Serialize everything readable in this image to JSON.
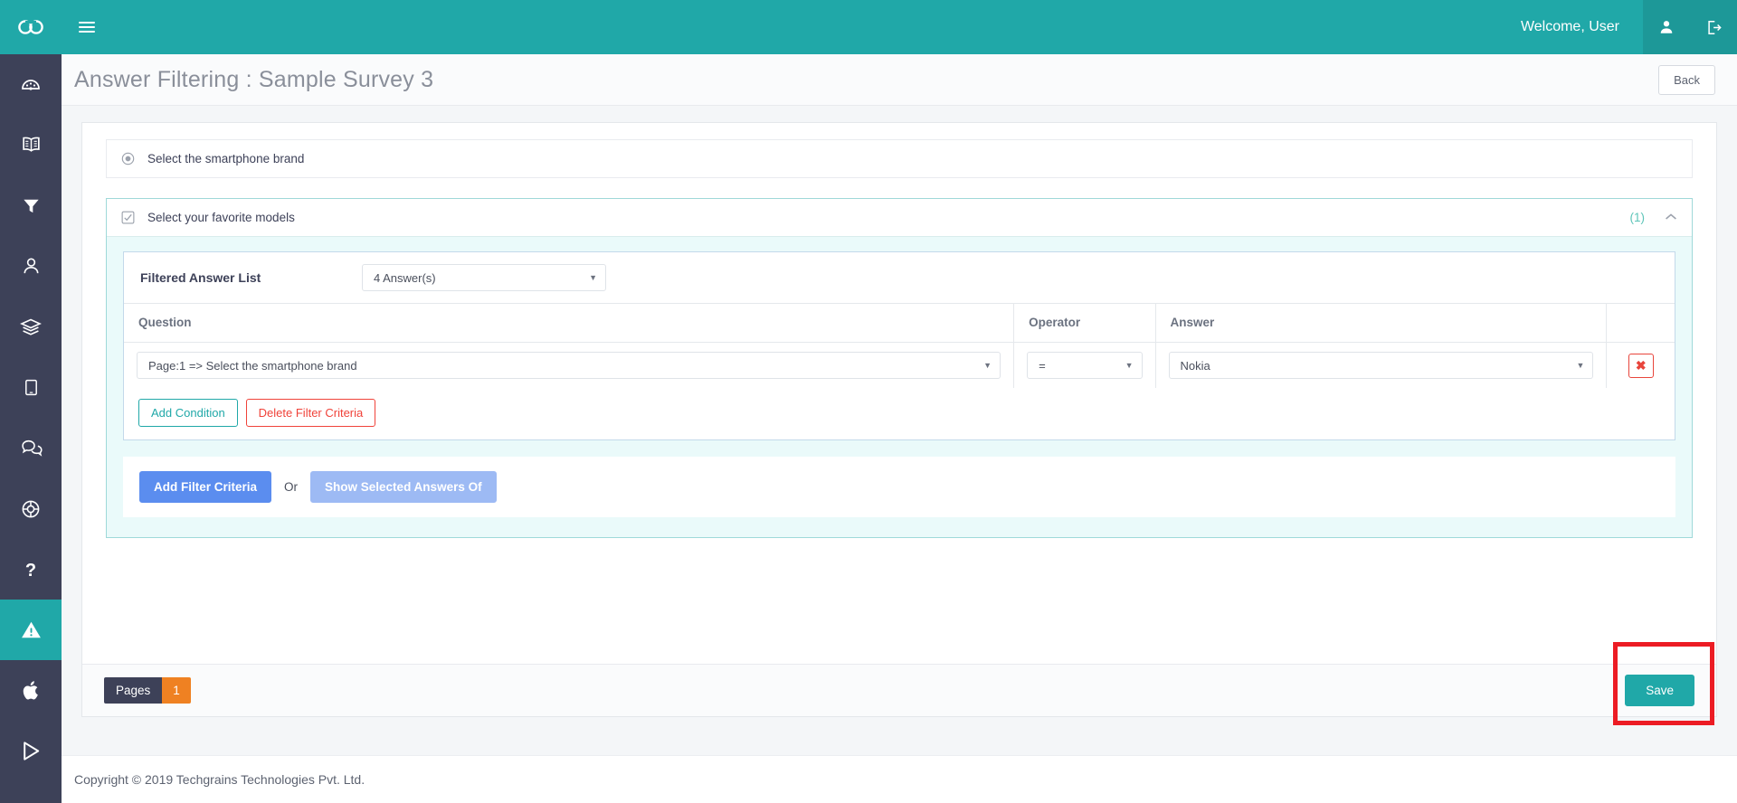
{
  "brand": {
    "logo_icon": "infinity-logo-icon",
    "accent_teal": "#20a8a8",
    "sidebar_bg": "#3d4158",
    "primary_blue": "#5b8def",
    "danger_red": "#f0433a",
    "orange": "#ef8122",
    "highlight_red": "#ec1c24"
  },
  "topbar": {
    "menu_icon": "hamburger-menu-icon",
    "welcome": "Welcome, User",
    "user_icon": "user-icon",
    "logout_icon": "logout-icon"
  },
  "sidebar": {
    "items": [
      {
        "icon": "dashboard-gauge-icon",
        "active": false
      },
      {
        "icon": "book-icon",
        "active": false
      },
      {
        "icon": "filter-funnel-icon",
        "active": false
      },
      {
        "icon": "user-profile-icon",
        "active": false
      },
      {
        "icon": "layers-icon",
        "active": false
      },
      {
        "icon": "tablet-device-icon",
        "active": false
      },
      {
        "icon": "chat-bubbles-icon",
        "active": false
      },
      {
        "icon": "life-ring-icon",
        "active": false
      },
      {
        "icon": "question-mark-icon",
        "active": false
      },
      {
        "icon": "warning-triangle-icon",
        "active": true
      },
      {
        "icon": "apple-logo-icon",
        "active": false
      },
      {
        "icon": "google-play-icon",
        "active": false
      }
    ]
  },
  "header": {
    "title": "Answer Filtering : Sample Survey 3",
    "back_label": "Back"
  },
  "main": {
    "collapsed_question": {
      "control_icon": "radio-button-icon",
      "label": "Select the smartphone brand"
    },
    "expanded_question": {
      "control_icon": "checkbox-checked-icon",
      "label": "Select your favorite models",
      "count": "(1)",
      "collapse_icon": "chevron-up-icon"
    },
    "criteria": {
      "title": "Filtered Answer List",
      "answers_select": {
        "value": "4 Answer(s)",
        "caret_icon": "caret-down-icon"
      },
      "columns": [
        "Question",
        "Operator",
        "Answer",
        ""
      ],
      "rows": [
        {
          "question": "Page:1 => Select the smartphone brand",
          "operator": "=",
          "answer": "Nokia",
          "delete_icon": "close-x-icon"
        }
      ],
      "add_condition_label": "Add Condition",
      "delete_criteria_label": "Delete Filter Criteria"
    },
    "actions": {
      "add_filter_criteria_label": "Add Filter Criteria",
      "or_label": "Or",
      "show_selected_label": "Show Selected Answers Of"
    },
    "footer_bar": {
      "pages_label": "Pages",
      "page_number": "1",
      "save_label": "Save"
    }
  },
  "footer": {
    "copyright": "Copyright © 2019 Techgrains Technologies Pvt. Ltd."
  }
}
